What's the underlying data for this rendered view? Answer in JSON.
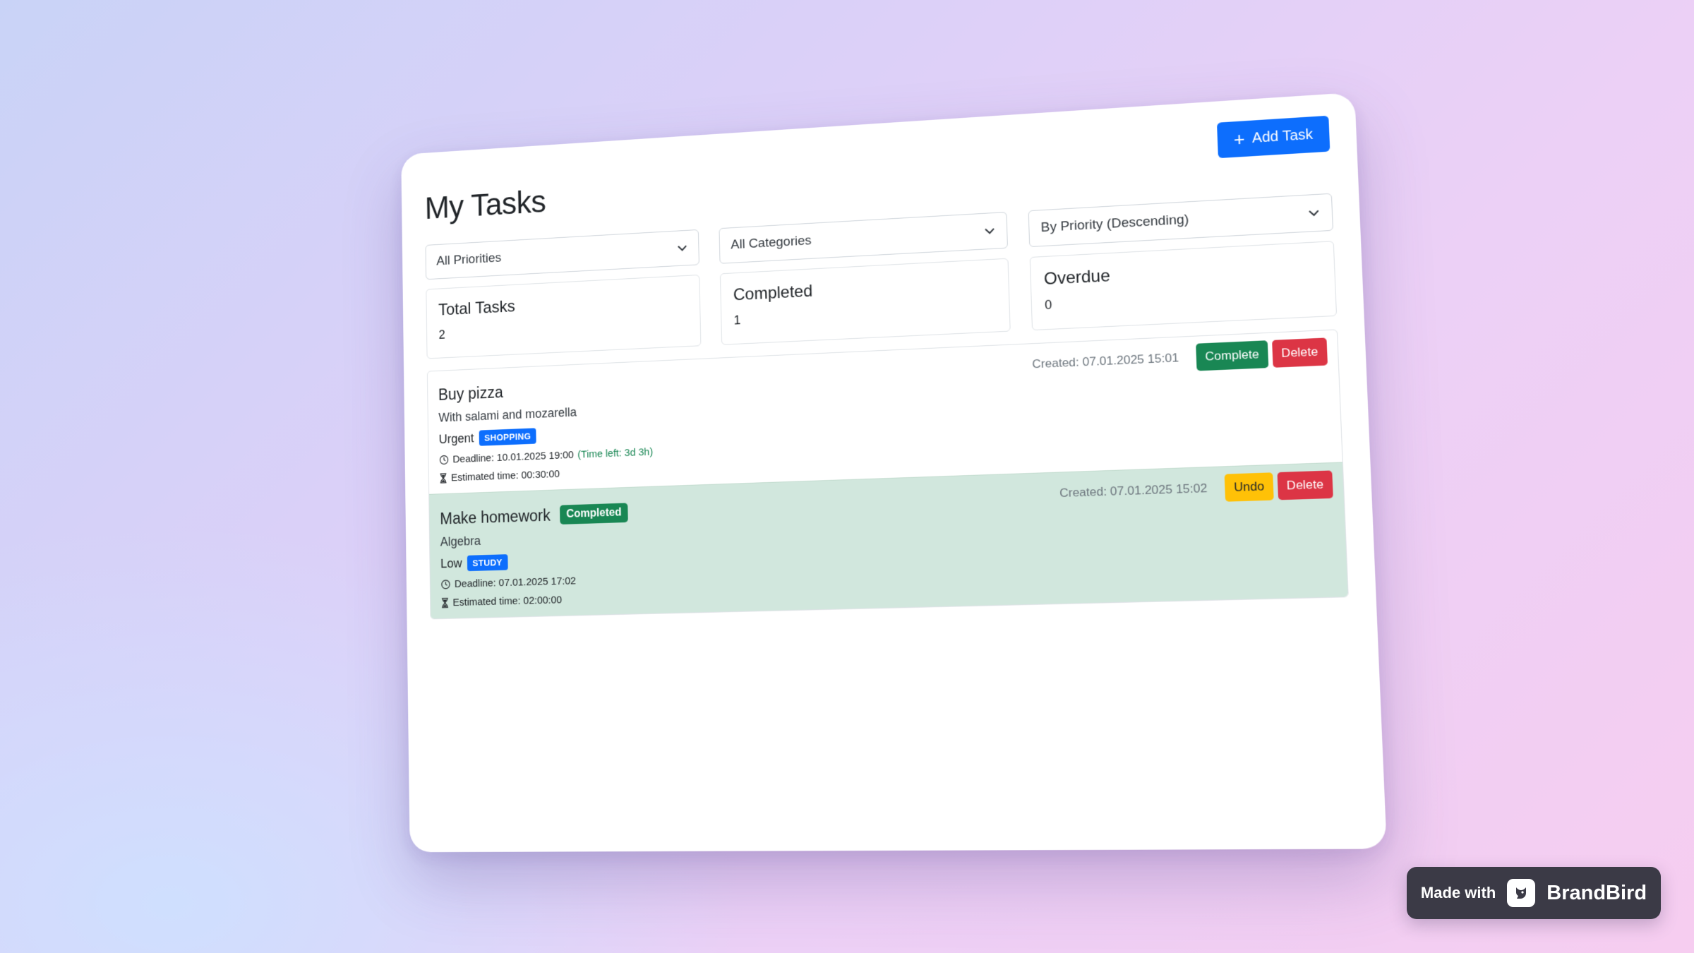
{
  "header": {
    "title": "My Tasks",
    "add_task_label": "Add Task"
  },
  "filters": {
    "priority": "All Priorities",
    "category": "All Categories",
    "sort": "By Priority (Descending)"
  },
  "stats": [
    {
      "title": "Total Tasks",
      "value": "2"
    },
    {
      "title": "Completed",
      "value": "1"
    },
    {
      "title": "Overdue",
      "value": "0"
    }
  ],
  "tasks": [
    {
      "title": "Buy pizza",
      "description": "With salami and mozarella",
      "priority": "Urgent",
      "category": "SHOPPING",
      "deadline": "Deadline: 10.01.2025 19:00",
      "time_left": "(Time left: 3d 3h)",
      "estimated": "Estimated time: 00:30:00",
      "created": "Created: 07.01.2025 15:01",
      "primary_action": "Complete",
      "delete_label": "Delete"
    },
    {
      "title": "Make homework",
      "status_badge": "Completed",
      "description": "Algebra",
      "priority": "Low",
      "category": "STUDY",
      "deadline": "Deadline: 07.01.2025 17:02",
      "estimated": "Estimated time: 02:00:00",
      "created": "Created: 07.01.2025 15:02",
      "primary_action": "Undo",
      "delete_label": "Delete"
    }
  ],
  "branding": {
    "made_with": "Made with",
    "brand": "BrandBird"
  },
  "colors": {
    "primary": "#0d6efd",
    "success": "#198754",
    "danger": "#dc3545",
    "warning": "#ffc107",
    "completed_row": "#d1e7dd"
  }
}
